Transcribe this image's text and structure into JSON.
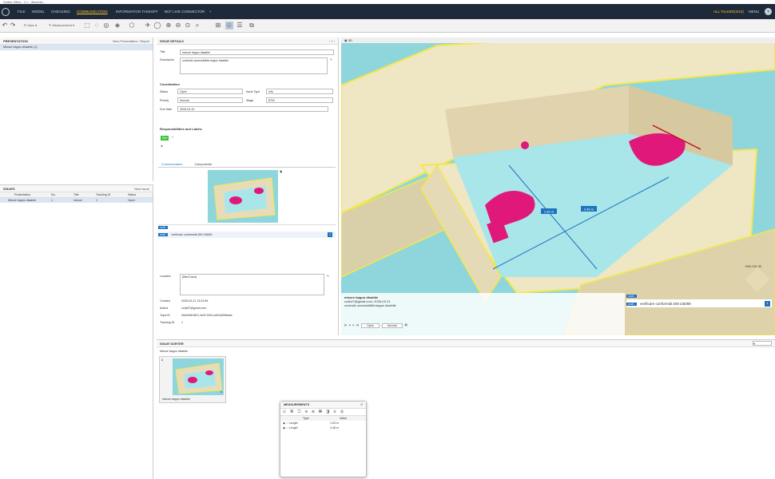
{
  "window": {
    "title": "Solibri Office - C:\\...\\Models\\..."
  },
  "menu": {
    "items": [
      "FILE",
      "MODEL",
      "CHECKING",
      "COMMUNICATION",
      "INFORMATION TAKEOFF",
      "BCF LIVE CONNECTOR",
      "+"
    ],
    "active": "COMMUNICATION",
    "user": "ALL TALKED(4/15)",
    "right_label": "MENU"
  },
  "toolbar": {
    "search_placeholder": "Search",
    "sync_label": "Sync",
    "measurement_label": "Measurement"
  },
  "presentation_panel": {
    "title": "PRESENTATION",
    "new_presentation": "New Presentation",
    "report": "Report",
    "item": "Misure bagno disabile (1)"
  },
  "issues_panel": {
    "title": "ISSUES",
    "new_issue": "New Issue",
    "columns": [
      "Presentation",
      "No.",
      "Title",
      "Tracking ID",
      "Status"
    ],
    "rows": [
      {
        "presentation": "Misure bagno disabile",
        "no": "1",
        "title": "misure",
        "tracking": "1",
        "status": "Open"
      }
    ]
  },
  "details": {
    "title": "ISSUE DETAILS",
    "title_label": "Title",
    "title_value": "misure bagno disabile",
    "description_label": "Description",
    "description_value": "controllo accessibilità bagno disabile",
    "coordination_title": "Coordination",
    "status_label": "Status",
    "status_value": "Open",
    "issue_type_label": "Issue Type",
    "issue_type_value": "Info",
    "priority_label": "Priority",
    "priority_value": "Normal",
    "stage_label": "Stage",
    "stage_value": "BTM",
    "due_label": "Due Date",
    "due_value": "2026-04-10",
    "resp_title": "Responsibilities and Labels",
    "tag": "BIM",
    "tab_comm": "Communication",
    "tab_comp": "Components",
    "comment_user": "ccdi..",
    "comment_text": "verificare conformità DM 236/89",
    "location_label": "Location",
    "location_value": "(Bim/Cand)",
    "created_label": "Created",
    "created_value": "2026-03-21 13:31:56",
    "author_label": "Author",
    "author_value": "ccdiof7@gmail.com",
    "typeid_label": "Topic ID",
    "typeid_value": "0bbe0fdf-8f21-4e0f-9323-a9e3d05fbabe",
    "tracking_label": "Tracking ID",
    "tracking_value": "1"
  },
  "view3d": {
    "title": "3D",
    "dim1": "1,53 m",
    "dim2": "2,48 m",
    "overlay_title": "misure bagno disabile",
    "overlay_meta": "ccdiof7@gmail.com, 2026-03-21",
    "overlay_desc": "controllo accessibilità bagno disabile",
    "chat_user": "ccdi..",
    "chat_text": "verificare conformità DM 236/89",
    "chat_badge": "1",
    "status_select": "Open",
    "priority_select": "Normal",
    "corner_label": "+959, 578, 89"
  },
  "sorter": {
    "title": "ISSUE SORTER",
    "group": "Misure bagno disabile",
    "card_no": "1",
    "card_label": "misure bagno disabile",
    "card_badge": "1"
  },
  "measurements": {
    "title": "MEASUREMENTS",
    "col_type": "Type",
    "col_value": "Value",
    "rows": [
      {
        "type": "Length",
        "value": "1,53 m"
      },
      {
        "type": "Length",
        "value": "2,48 m"
      }
    ]
  },
  "colors": {
    "accent": "#1e73be",
    "menu_bg": "#1e2a3a",
    "active": "#f2c230",
    "pink": "#e0187a",
    "tag_green": "#3bbf3b"
  }
}
